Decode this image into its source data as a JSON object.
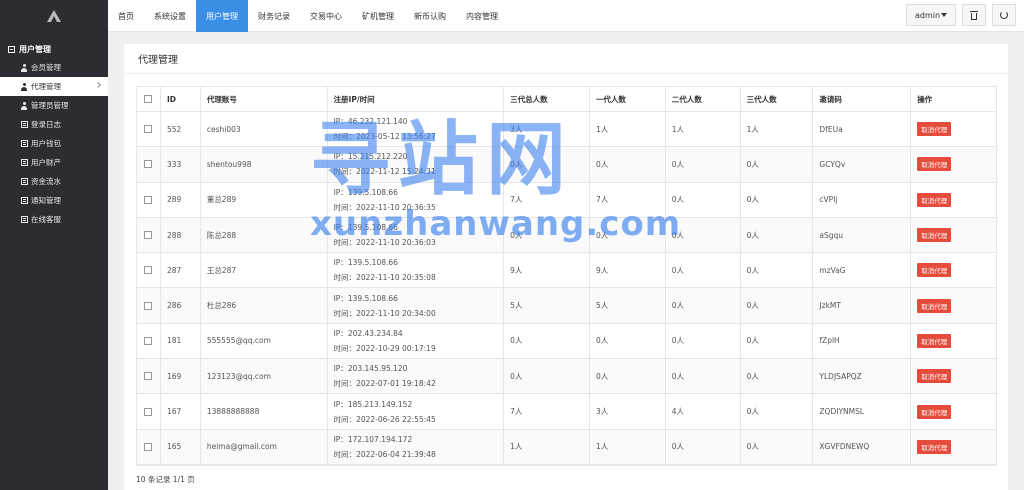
{
  "sidebar": {
    "section_title": "用户管理",
    "items": [
      {
        "label": "会员管理",
        "icon": "user-icon",
        "active": false
      },
      {
        "label": "代理管理",
        "icon": "user-icon",
        "active": true
      },
      {
        "label": "管理员管理",
        "icon": "user-icon",
        "active": false
      },
      {
        "label": "登录日志",
        "icon": "list-icon",
        "active": false
      },
      {
        "label": "用户钱包",
        "icon": "list-icon",
        "active": false
      },
      {
        "label": "用户财产",
        "icon": "list-icon",
        "active": false
      },
      {
        "label": "资金流水",
        "icon": "list-icon",
        "active": false
      },
      {
        "label": "通知管理",
        "icon": "list-icon",
        "active": false
      },
      {
        "label": "在线客服",
        "icon": "list-icon",
        "active": false
      }
    ]
  },
  "nav": {
    "items": [
      "首页",
      "系统设置",
      "用户管理",
      "财务记录",
      "交易中心",
      "矿机管理",
      "新币认购",
      "内容管理"
    ],
    "active_index": 2
  },
  "header": {
    "user": "admin",
    "accent": "#3a8ee6"
  },
  "panel": {
    "title": "代理管理"
  },
  "table": {
    "headers": [
      "ID",
      "代理账号",
      "注册IP/时间",
      "三代总人数",
      "一代人数",
      "二代人数",
      "三代人数",
      "邀请码",
      "操作"
    ],
    "ip_prefix": "IP：",
    "time_prefix": "时间：",
    "action_label": "取消代理",
    "action_color": "#e64c3c",
    "rows": [
      {
        "id": "552",
        "account": "ceshi003",
        "ip": "46.232.121.140",
        "time": "2023-05-12 13:56:27",
        "total": "3人",
        "g1": "1人",
        "g2": "1人",
        "g3": "1人",
        "code": "DfEUa"
      },
      {
        "id": "333",
        "account": "shentou998",
        "ip": "15.215.212.220",
        "time": "2022-11-12 15:24:31",
        "total": "0人",
        "g1": "0人",
        "g2": "0人",
        "g3": "0人",
        "code": "GCYQv"
      },
      {
        "id": "289",
        "account": "董总289",
        "ip": "139.5.108.66",
        "time": "2022-11-10 20:36:35",
        "total": "7人",
        "g1": "7人",
        "g2": "0人",
        "g3": "0人",
        "code": "cVPIj"
      },
      {
        "id": "288",
        "account": "陈总288",
        "ip": "139.5.108.66",
        "time": "2022-11-10 20:36:03",
        "total": "0人",
        "g1": "0人",
        "g2": "0人",
        "g3": "0人",
        "code": "aSgqu"
      },
      {
        "id": "287",
        "account": "王总287",
        "ip": "139.5.108.66",
        "time": "2022-11-10 20:35:08",
        "total": "9人",
        "g1": "9人",
        "g2": "0人",
        "g3": "0人",
        "code": "mzVaG"
      },
      {
        "id": "286",
        "account": "杜总286",
        "ip": "139.5.108.66",
        "time": "2022-11-10 20:34:00",
        "total": "5人",
        "g1": "5人",
        "g2": "0人",
        "g3": "0人",
        "code": "JzkMT"
      },
      {
        "id": "181",
        "account": "555555@qq.com",
        "ip": "202.43.234.84",
        "time": "2022-10-29 00:17:19",
        "total": "0人",
        "g1": "0人",
        "g2": "0人",
        "g3": "0人",
        "code": "fZplH"
      },
      {
        "id": "169",
        "account": "123123@qq.com",
        "ip": "203.145.95.120",
        "time": "2022-07-01 19:18:42",
        "total": "0人",
        "g1": "0人",
        "g2": "0人",
        "g3": "0人",
        "code": "YLDJSAPQZ"
      },
      {
        "id": "167",
        "account": "13888888888",
        "ip": "185.213.149.152",
        "time": "2022-06-26 22:55:45",
        "total": "7人",
        "g1": "3人",
        "g2": "4人",
        "g3": "0人",
        "code": "ZQDIYNMSL"
      },
      {
        "id": "165",
        "account": "heima@gmail.com",
        "ip": "172.107.194.172",
        "time": "2022-06-04 21:39:48",
        "total": "1人",
        "g1": "1人",
        "g2": "0人",
        "g3": "0人",
        "code": "XGVFDNEWQ"
      }
    ]
  },
  "footer": {
    "summary": "10 条记录 1/1 页"
  },
  "watermark": {
    "big": "寻站网",
    "small": "xunzhanwang.com"
  }
}
